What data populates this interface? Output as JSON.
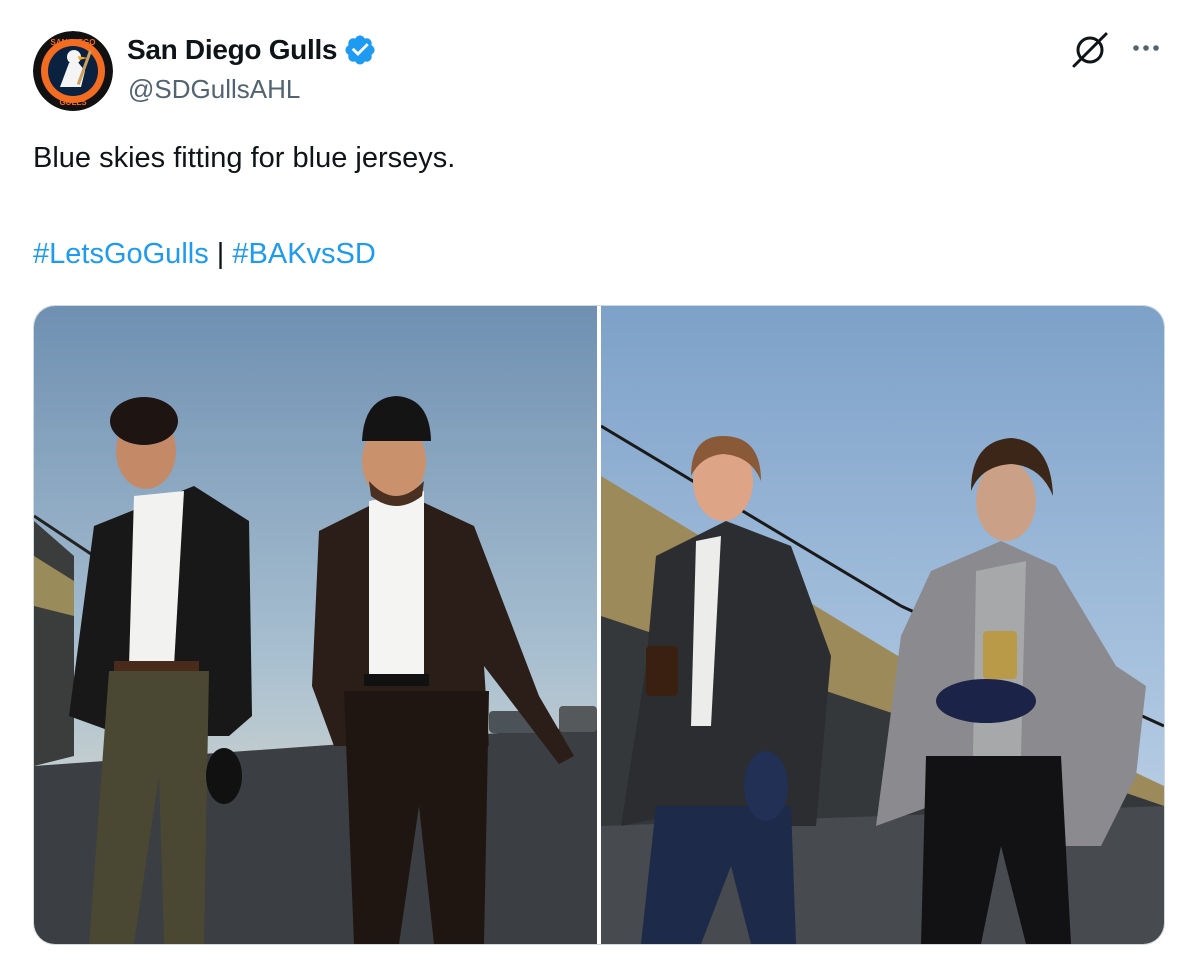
{
  "author": {
    "name": "San Diego Gulls",
    "handle": "@SDGullsAHL",
    "verified": true,
    "avatar_icon": "san-diego-gulls-logo",
    "avatar_text_top": "SAN DIEGO",
    "avatar_text_bottom": "GULLS"
  },
  "actions": {
    "grok_icon": "grok-icon",
    "more_icon": "more-options-icon"
  },
  "tweet": {
    "text": "Blue skies fitting for blue jerseys.",
    "hashtags": [
      "#LetsGoGulls",
      "#BAKvsSD"
    ],
    "separator": "|"
  },
  "media": {
    "count": 2,
    "photos": [
      {
        "subject": "two players in suits walking, one in black beanie, under blue sky"
      },
      {
        "subject": "two players in coats walking, holding drinks and caps, under blue sky"
      }
    ]
  },
  "colors": {
    "link": "#1d9bf0",
    "text": "#0f1419",
    "secondary": "#536471",
    "verified": "#1d9bf0"
  }
}
